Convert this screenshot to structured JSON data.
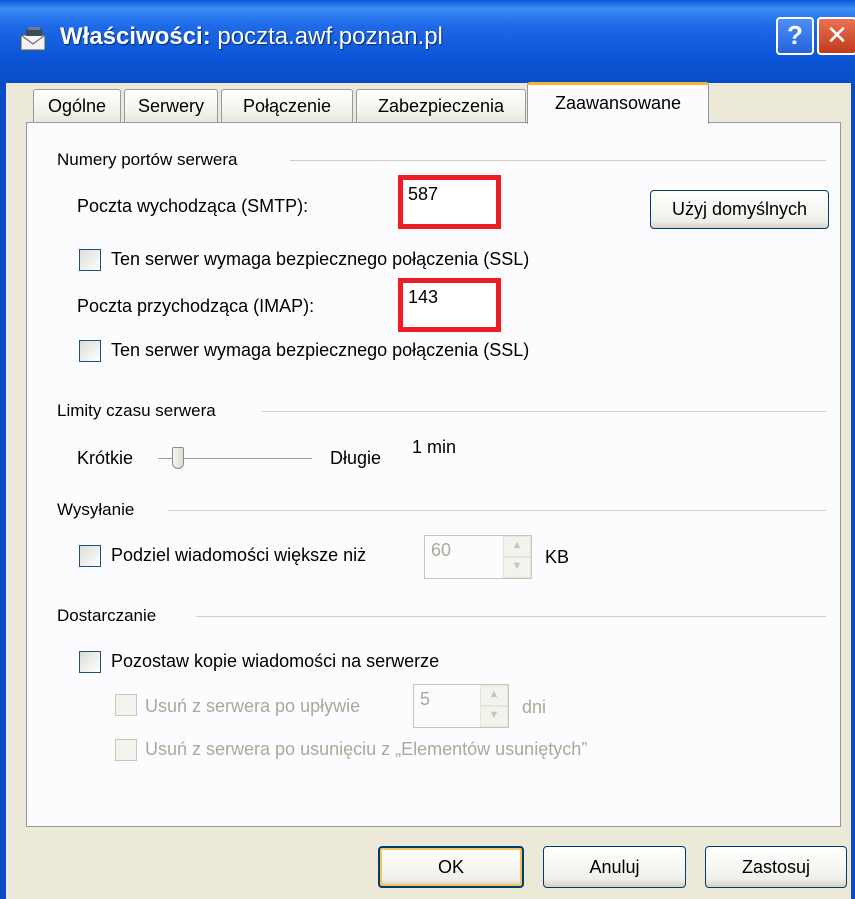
{
  "window": {
    "title_bold": "Właściwości:",
    "title_rest": " poczta.awf.poznan.pl",
    "help": "?",
    "close": "✕"
  },
  "tabs": [
    {
      "label": "Ogólne"
    },
    {
      "label": "Serwery"
    },
    {
      "label": "Połączenie"
    },
    {
      "label": "Zabezpieczenia"
    },
    {
      "label": "Zaawansowane",
      "active": true
    }
  ],
  "ports": {
    "group": "Numery portów serwera",
    "smtp_label": "Poczta wychodząca (SMTP):",
    "smtp_value": "587",
    "smtp_ssl": "Ten serwer wymaga bezpiecznego połączenia (SSL)",
    "imap_label": "Poczta przychodząca (IMAP):",
    "imap_value": "143",
    "imap_ssl": "Ten serwer wymaga bezpiecznego połączenia (SSL)",
    "defaults_button": "Użyj domyślnych"
  },
  "timeout": {
    "group": "Limity czasu serwera",
    "short": "Krótkie",
    "long": "Długie",
    "value": "1 min",
    "level": 0.1
  },
  "sending": {
    "group": "Wysyłanie",
    "split_label": "Podziel wiadomości większe niż",
    "split_value": "60",
    "unit": "KB"
  },
  "delivery": {
    "group": "Dostarczanie",
    "keep_copies": "Pozostaw kopie wiadomości na serwerze",
    "remove_after": "Usuń z serwera po upływie",
    "remove_after_value": "5",
    "days": "dni",
    "remove_deleted": "Usuń z serwera po usunięciu z „Elementów usuniętych”"
  },
  "buttons": {
    "ok": "OK",
    "cancel": "Anuluj",
    "apply": "Zastosuj"
  },
  "colors": {
    "highlight": "#ee1c24",
    "titlebar": "#0a55d6"
  }
}
